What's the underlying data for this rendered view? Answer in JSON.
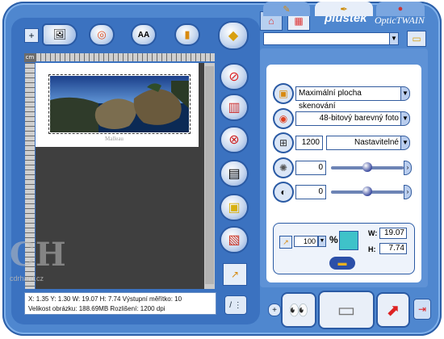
{
  "branding": {
    "vendor": "plustek",
    "product": "OpticTWAIN"
  },
  "watermark": {
    "logo": "CH",
    "text": "cdrhard.cz"
  },
  "toolbar": {
    "zoom_in_icon": "plus-icon",
    "preview_icon": "preview-icon",
    "help_icon": "lifebuoy-icon",
    "ocr_label": "AA",
    "book_icon": "book-icon",
    "scan_icon": "scan-icon"
  },
  "ruler": {
    "unit": "cm"
  },
  "preview": {
    "caption": "Malleau"
  },
  "status": {
    "line1": "X: 1.35   Y: 1.30   W: 19.07   H: 7.74   Výstupní měřítko: 10",
    "line2": "Velikost obrázku: 188.69MB   Rozlišení: 1200 dpi"
  },
  "settings": {
    "tabs": [
      "tab-general",
      "tab-adjust",
      "tab-advanced"
    ],
    "scan_area": "Maximální plocha skenování",
    "scan_mode": "48-bitový barevný foto",
    "resolution": "1200",
    "resolution_preset": "Nastavitelné",
    "brightness": "0",
    "contrast": "0",
    "brightness_level": 0.5,
    "contrast_level": 0.5
  },
  "size": {
    "scale": "100",
    "percent": "%",
    "w_label": "W:",
    "w_value": "19.07",
    "h_label": "H:",
    "h_value": "7.74"
  },
  "profile": {
    "current": ""
  },
  "colors": {
    "frame": "#4f87cf",
    "panel": "#5e92d6",
    "canvas": "#3f3f3f"
  }
}
